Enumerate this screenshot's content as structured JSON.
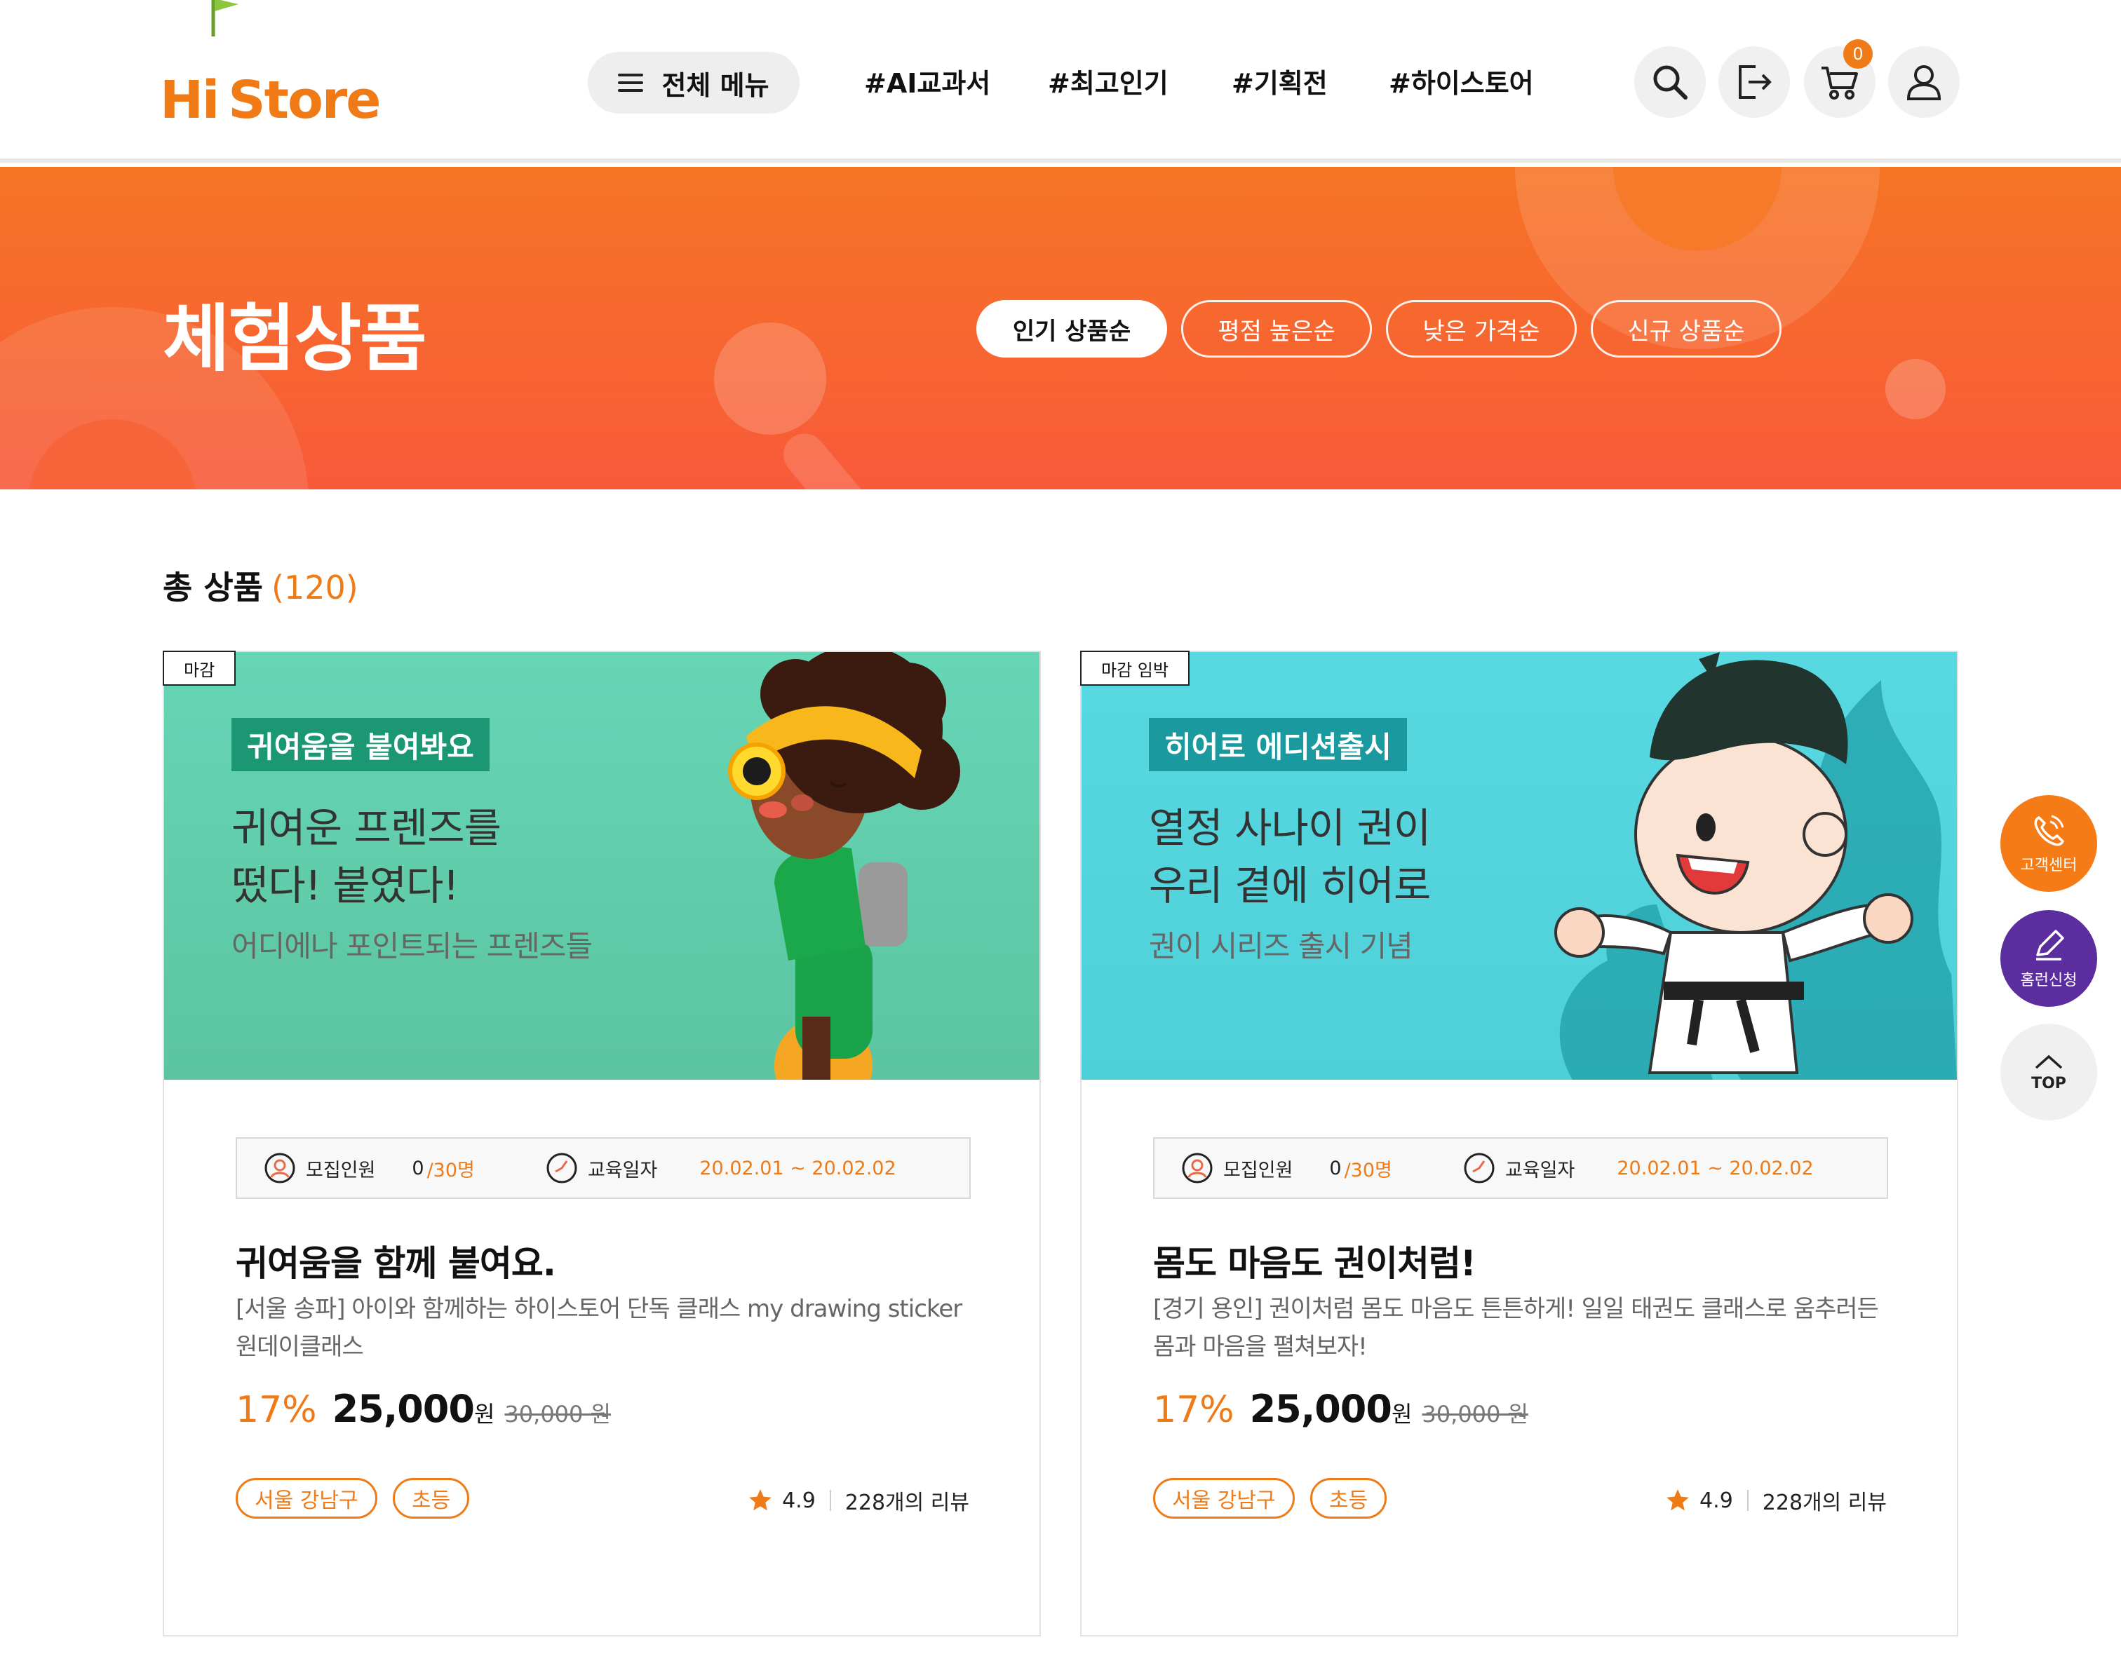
{
  "header": {
    "logo": {
      "hi": "Hi",
      "store": "Store"
    },
    "menu_label": "전체 메뉴",
    "nav": [
      "#AI교과서",
      "#최고인기",
      "#기획전",
      "#하이스토어"
    ],
    "icons": [
      "search-icon",
      "logout-icon",
      "cart-icon",
      "user-icon"
    ],
    "cart_count": "0"
  },
  "banner": {
    "title": "체험상품",
    "sort_options": [
      "인기 상품순",
      "평점 높은순",
      "낮은 가격순",
      "신규 상품순"
    ],
    "active_sort": "인기 상품순"
  },
  "total": {
    "label": "총 상품",
    "count": "(120)"
  },
  "cards": [
    {
      "status": "마감",
      "image": {
        "badge": "귀여움을 붙여봐요",
        "headline_1": "귀여운 프렌즈를",
        "headline_2": "떴다! 붙였다!",
        "sub": "어디에나 포인트되는 프렌즈들",
        "bg": "#62d3b0",
        "badge_bg": "#1b9873"
      },
      "recruit_label": "모집인원",
      "recruit_current": "0",
      "recruit_total": "/30명",
      "date_label": "교육일자",
      "date_value": "20.02.01 ~ 20.02.02",
      "title": "귀여움을 함께 붙여요.",
      "desc": "[서울 송파] 아이와 함께하는 하이스토어 단독 클래스 my drawing sticker 원데이클래스",
      "discount": "17%",
      "price": "25,000",
      "won": "원",
      "original_price": "30,000 원",
      "chips": [
        "서울 강남구",
        "초등"
      ],
      "rating": "4.9",
      "reviews": "228개의 리뷰"
    },
    {
      "status": "마감 임박",
      "image": {
        "badge": "히어로 에디션출시",
        "headline_1": "열정 사나이 권이",
        "headline_2": "우리 곁에 히어로",
        "sub": "권이 시리즈 출시 기념",
        "bg": "#55d6de",
        "badge_bg": "#1a9a9e"
      },
      "recruit_label": "모집인원",
      "recruit_current": "0",
      "recruit_total": "/30명",
      "date_label": "교육일자",
      "date_value": "20.02.01 ~ 20.02.02",
      "title": "몸도 마음도 권이처럼!",
      "desc": "[경기 용인] 권이처럼 몸도 마음도 튼튼하게! 일일 태권도 클래스로 움추러든 몸과 마음을 펼쳐보자!",
      "discount": "17%",
      "price": "25,000",
      "won": "원",
      "original_price": "30,000 원",
      "chips": [
        "서울 강남구",
        "초등"
      ],
      "rating": "4.9",
      "reviews": "228개의 리뷰"
    }
  ],
  "floating": {
    "support": "고객센터",
    "homerun": "홈런신청",
    "top": "TOP"
  },
  "colors": {
    "accent": "#f07a16",
    "banner_top": "#f67424",
    "banner_bottom": "#f85a3a",
    "homerun": "#5b2d9e"
  }
}
